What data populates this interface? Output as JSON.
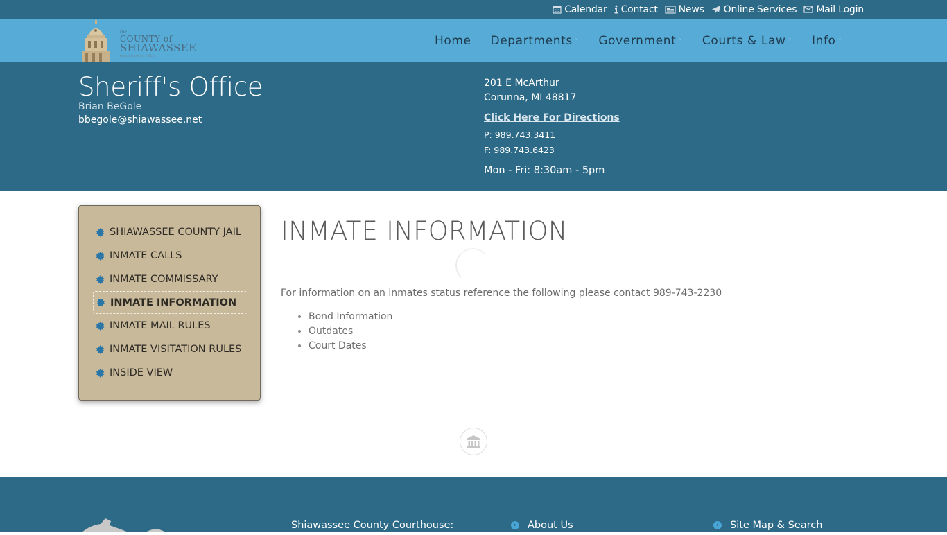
{
  "utility_bar": {
    "links": [
      {
        "label": "Calendar",
        "icon": "calendar-icon"
      },
      {
        "label": "Contact",
        "icon": "info-icon"
      },
      {
        "label": "News",
        "icon": "newspaper-icon"
      },
      {
        "label": "Online Services",
        "icon": "paper-plane-icon"
      },
      {
        "label": "Mail Login",
        "icon": "envelope-icon"
      }
    ]
  },
  "logo": {
    "line1": "the",
    "line2": "COUNTY of",
    "line3": "SHIAWASSEE",
    "line4": "established in 1822"
  },
  "nav": {
    "items": [
      {
        "label": "Home",
        "has_dropdown": false
      },
      {
        "label": "Departments",
        "has_dropdown": true
      },
      {
        "label": "Government",
        "has_dropdown": true
      },
      {
        "label": "Courts & Law",
        "has_dropdown": true
      },
      {
        "label": "Info",
        "has_dropdown": true
      }
    ]
  },
  "header": {
    "title": "Sheriff's Office",
    "person": "Brian BeGole",
    "email": "bbegole@shiawassee.net",
    "address_line1": "201 E McArthur",
    "address_line2": "Corunna, MI 48817",
    "directions_label": "Click Here For Directions",
    "phone": "P: 989.743.3411",
    "fax": "F: 989.743.6423",
    "hours": "Mon - Fri: 8:30am - 5pm"
  },
  "sidebar": {
    "items": [
      {
        "label": "SHIAWASSEE COUNTY JAIL",
        "active": false
      },
      {
        "label": "INMATE CALLS",
        "active": false
      },
      {
        "label": "INMATE COMMISSARY",
        "active": false
      },
      {
        "label": "INMATE INFORMATION",
        "active": true
      },
      {
        "label": "INMATE MAIL RULES",
        "active": false
      },
      {
        "label": "INMATE VISITATION RULES",
        "active": false
      },
      {
        "label": "INSIDE VIEW",
        "active": false
      }
    ]
  },
  "main": {
    "title": "INMATE INFORMATION",
    "intro": "For information on an inmates status reference the following please contact 989-743-2230",
    "list": [
      "Bond Information",
      "Outdates",
      "Court Dates"
    ]
  },
  "footer": {
    "courthouse_label": "Shiawassee County Courthouse:",
    "links": [
      {
        "label": "About Us"
      },
      {
        "label": "Site Map & Search"
      }
    ]
  },
  "colors": {
    "primary_dark": "#2c6a87",
    "nav_blue": "#56acd6",
    "sidebar_tan": "#c8b99b",
    "bullet_blue": "#2a76a6"
  }
}
